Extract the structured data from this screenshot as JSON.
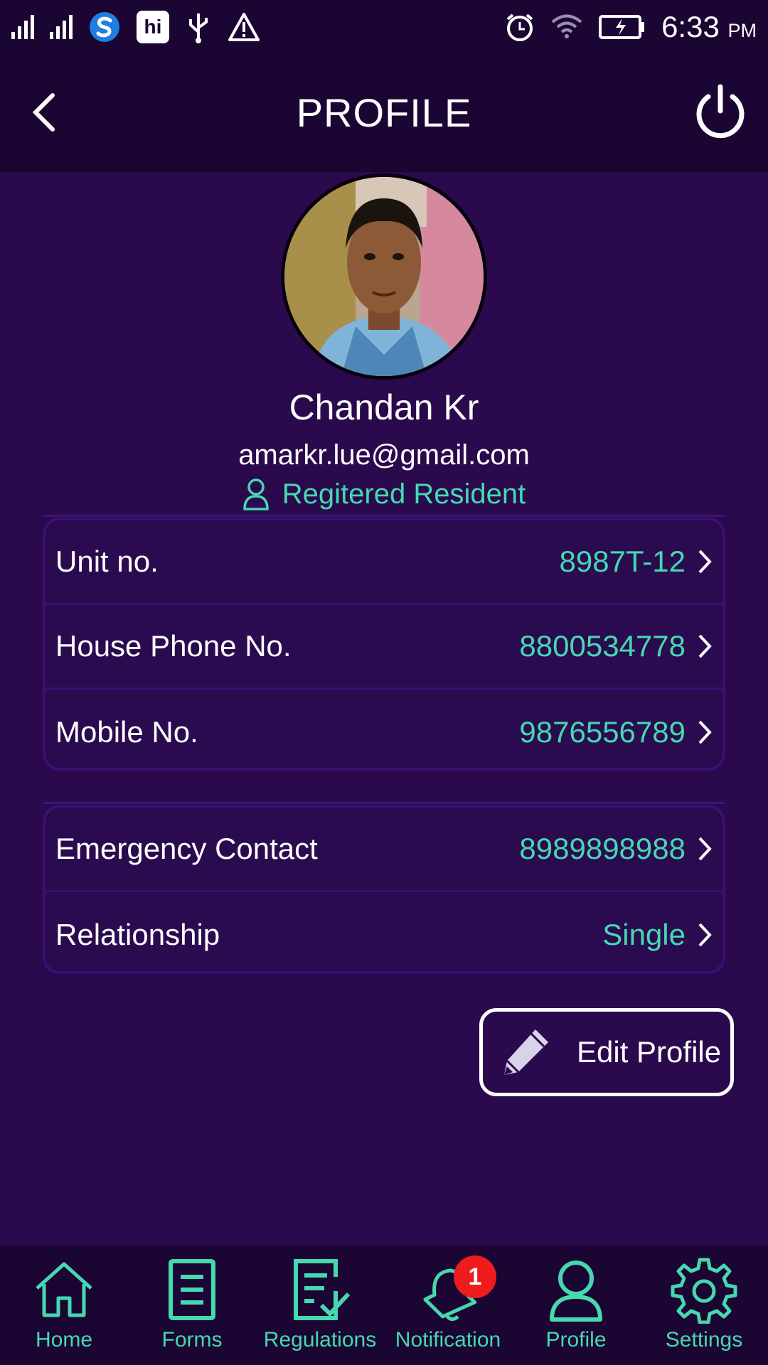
{
  "status_bar": {
    "time": "6:33",
    "ampm": "PM",
    "app_badge": "hi"
  },
  "header": {
    "title": "PROFILE"
  },
  "profile": {
    "name": "Chandan Kr",
    "email": "amarkr.lue@gmail.com",
    "status": "Regitered Resident"
  },
  "details_card": [
    {
      "label": "Unit no.",
      "value": "8987T-12"
    },
    {
      "label": "House Phone No.",
      "value": "8800534778"
    },
    {
      "label": "Mobile No.",
      "value": "9876556789"
    }
  ],
  "emergency_card": [
    {
      "label": "Emergency Contact",
      "value": "8989898988"
    },
    {
      "label": "Relationship",
      "value": "Single"
    }
  ],
  "edit_button": {
    "label": "Edit Profile"
  },
  "bottom_nav": {
    "items": [
      {
        "label": "Home",
        "icon": "home-icon"
      },
      {
        "label": "Forms",
        "icon": "forms-icon"
      },
      {
        "label": "Regulations",
        "icon": "regulations-icon"
      },
      {
        "label": "Notification",
        "icon": "bell-icon",
        "badge": "1"
      },
      {
        "label": "Profile",
        "icon": "person-icon"
      },
      {
        "label": "Settings",
        "icon": "gear-icon"
      }
    ]
  },
  "colors": {
    "background": "#2a0a4c",
    "header": "#1b0533",
    "accent": "#45d8b1",
    "card_border": "#3a0f73",
    "badge": "#ee1c1c"
  }
}
